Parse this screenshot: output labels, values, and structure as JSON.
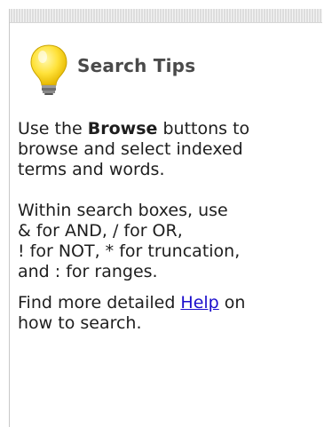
{
  "panel": {
    "title": "Search Tips",
    "bulb_icon": "lightbulb-icon",
    "colors": {
      "title": "#4a4a4a",
      "text": "#1e1e1e",
      "link": "#1a0dcc",
      "bulb": "#ffe23a",
      "bulb_base": "#7a7a7a"
    },
    "tip1": {
      "before": "Use the ",
      "bold": "Browse",
      "after": " buttons to",
      "line2": "browse and select indexed",
      "line3": "terms and words."
    },
    "tip2": {
      "line1": "Within search boxes, use",
      "line2": "& for AND, / for OR,",
      "line3": "! for NOT, * for truncation,",
      "line4": "and : for ranges."
    },
    "tip3": {
      "before": "Find more detailed ",
      "link": "Help",
      "after": " on",
      "line2": "how to search."
    }
  }
}
